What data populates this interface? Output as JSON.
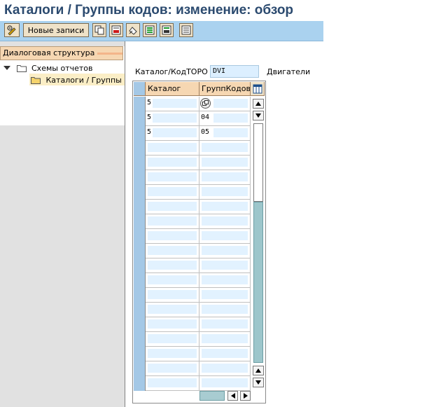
{
  "window": {
    "title": "Каталоги / Группы кодов: изменение: обзор"
  },
  "toolbar": {
    "new_entries_label": "Новые записи",
    "icons": [
      "display-change-icon",
      "copy-icon",
      "delete-icon",
      "undo-icon",
      "select-all-icon",
      "select-block-icon",
      "deselect-all-icon"
    ]
  },
  "tree": {
    "header": "Диалоговая структура",
    "items": [
      {
        "label": "Схемы отчетов",
        "expanded": true
      },
      {
        "label": "Каталоги / Группы ко",
        "selected": true
      }
    ]
  },
  "filter": {
    "label": "Каталог/КодТОРО",
    "value": "DVI",
    "description": "Двигатели"
  },
  "table": {
    "columns": [
      "Каталог",
      "ГруппКодов"
    ],
    "rows": [
      {
        "catalog": "5",
        "group": ""
      },
      {
        "catalog": "5",
        "group": "04"
      },
      {
        "catalog": "5",
        "group": "05"
      }
    ],
    "total_rows": 20
  },
  "colors": {
    "title": "#2b4a6f",
    "toolbar": "#aad2ef",
    "header": "#f6d7b2",
    "input": "#dcefff"
  }
}
